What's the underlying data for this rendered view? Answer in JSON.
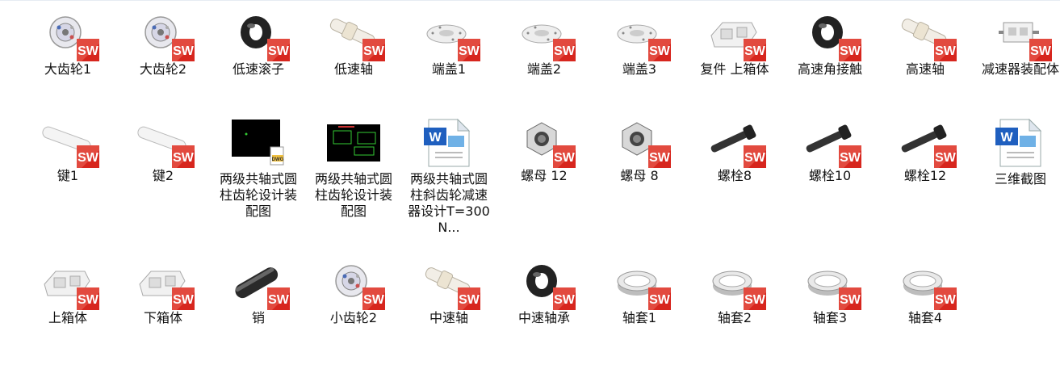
{
  "files": [
    {
      "label": "大齿轮1",
      "icon": "gear-sw-icon"
    },
    {
      "label": "大齿轮2",
      "icon": "gear-sw-icon"
    },
    {
      "label": "低速滚子",
      "icon": "bearing-sw-icon"
    },
    {
      "label": "低速轴",
      "icon": "shaft-sw-icon"
    },
    {
      "label": "端盖1",
      "icon": "end-cap-sw-icon"
    },
    {
      "label": "端盖2",
      "icon": "end-cap-sw-icon"
    },
    {
      "label": "端盖3",
      "icon": "end-cap-sw-icon"
    },
    {
      "label": "复件 上箱体",
      "icon": "housing-sw-icon"
    },
    {
      "label": "高速角接触",
      "icon": "bearing-sw-icon"
    },
    {
      "label": "高速轴",
      "icon": "shaft-sw-icon"
    },
    {
      "label": "减速器装配体",
      "icon": "assembly-sw-icon"
    },
    {
      "label": "键1",
      "icon": "key-sw-icon"
    },
    {
      "label": "键2",
      "icon": "key-sw-icon"
    },
    {
      "label": "两级共轴式圆柱齿轮设计装配图",
      "icon": "dwg-icon"
    },
    {
      "label": "两级共轴式圆柱齿轮设计装配图",
      "icon": "drawing-thumbnail-icon"
    },
    {
      "label": "两级共轴式圆柱斜齿轮减速器设计T=300N...",
      "icon": "word-document-icon"
    },
    {
      "label": "螺母  12",
      "icon": "nut-sw-icon"
    },
    {
      "label": "螺母 8",
      "icon": "nut-sw-icon"
    },
    {
      "label": "螺栓8",
      "icon": "bolt-sw-icon"
    },
    {
      "label": "螺栓10",
      "icon": "bolt-sw-icon"
    },
    {
      "label": "螺栓12",
      "icon": "bolt-sw-icon"
    },
    {
      "label": "三维截图",
      "icon": "word-document-icon"
    },
    {
      "label": "上箱体",
      "icon": "housing-sw-icon"
    },
    {
      "label": "下箱体",
      "icon": "housing-sw-icon"
    },
    {
      "label": "销",
      "icon": "pin-sw-icon"
    },
    {
      "label": "小齿轮2",
      "icon": "gear-sw-icon"
    },
    {
      "label": "中速轴",
      "icon": "shaft-sw-icon"
    },
    {
      "label": "中速轴承",
      "icon": "bearing-sw-icon"
    },
    {
      "label": "轴套1",
      "icon": "sleeve-sw-icon"
    },
    {
      "label": "轴套2",
      "icon": "sleeve-sw-icon"
    },
    {
      "label": "轴套3",
      "icon": "sleeve-sw-icon"
    },
    {
      "label": "轴套4",
      "icon": "sleeve-sw-icon"
    }
  ],
  "colors": {
    "sw_red": "#d7261e",
    "label_text": "#111111",
    "background": "#ffffff"
  }
}
